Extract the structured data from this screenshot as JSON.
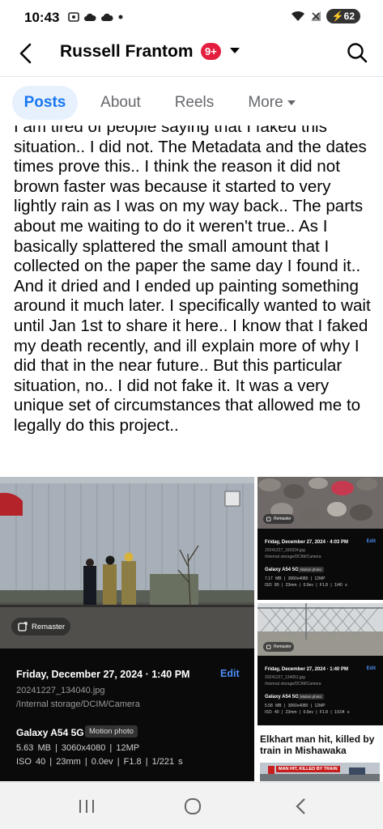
{
  "status_bar": {
    "time": "10:43",
    "battery": "62"
  },
  "header": {
    "name": "Russell Frantom",
    "notification_badge": "9+"
  },
  "tabs": [
    {
      "label": "Posts",
      "active": true
    },
    {
      "label": "About",
      "active": false
    },
    {
      "label": "Reels",
      "active": false
    },
    {
      "label": "More",
      "active": false
    }
  ],
  "post": {
    "text": "I am tired of people saying that I faked this situation.. I did not. The Metadata and the dates times prove this.. I think the reason it did not brown faster was because it started to very lightly rain as I was on my way back.. The parts about me waiting to do it weren't true.. As I basically splattered the small amount that I collected on the paper the same day I found it.. And it dried and I ended up painting something around it much later. I specifically wanted to wait until Jan 1st to share it here.. I know that I faked my death recently, and ill explain more of why I did that in the near future.. But this particular situation, no.. I did not fake it. It was a very unique set of circumstances that allowed me to legally do this project.."
  },
  "photos": {
    "remaster_label": "Remaster",
    "edit_label": "Edit",
    "main": {
      "date": "Friday, December 27, 2024 · 1:40 PM",
      "filename": "20241227_134040.jpg",
      "path": "/Internal storage/DCIM/Camera",
      "device": "Galaxy A54 5G",
      "motion_tag": "Motion photo",
      "specs_line1": "5.63 MB  |  3060x4080  |  12MP",
      "specs_line2": "ISO 40  |  23mm  |  0.0ev  |  F1.8  |  1/221 s"
    },
    "small1": {
      "date": "Friday, December 27, 2024 · 4:03 PM",
      "filename": "20241227_160324.jpg",
      "path": "/Internal storage/DCIM/Camera",
      "device": "Galaxy A54 5G",
      "motion_tag": "Motion photo",
      "specs_line1": "7.17 MB  |  3060x4080  |  12MP",
      "specs_line2": "ISO 80  |  23mm  |  0.0ev  |  F1.8  |  1/40 s"
    },
    "small2": {
      "date": "Friday, December 27, 2024 · 1:40 PM",
      "filename": "20241227_134051.jpg",
      "path": "/Internal storage/DCIM/Camera",
      "device": "Galaxy A54 5G",
      "motion_tag": "Motion photo",
      "specs_line1": "5.58 MB  |  3060x4080  |  12MP",
      "specs_line2": "ISO 40  |  23mm  |  0.0ev  |  F1.8  |  1/104 s"
    },
    "news": {
      "headline": "Elkhart man hit, killed by train in Mishawaka",
      "tag": "MAN HIT, KILLED BY TRAIN"
    }
  }
}
